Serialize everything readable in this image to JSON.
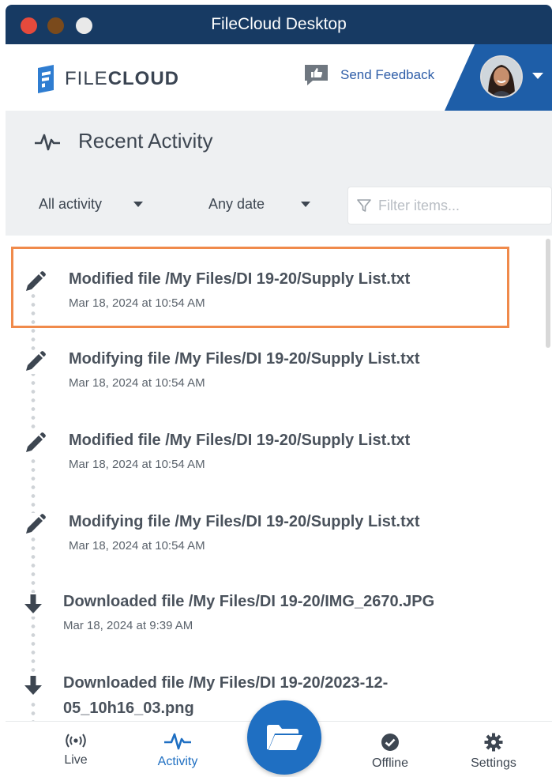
{
  "window": {
    "title": "FileCloud Desktop"
  },
  "header": {
    "logo_text_light": "FILE",
    "logo_text_bold": "CLOUD",
    "feedback_label": "Send Feedback"
  },
  "section": {
    "title": "Recent Activity"
  },
  "filters": {
    "activity_value": "All activity",
    "date_value": "Any date",
    "search_placeholder": "Filter items..."
  },
  "activities": [
    {
      "icon": "pencil-icon",
      "title": "Modified file /My Files/DI 19-20/Supply List.txt",
      "time": "Mar 18, 2024 at 10:54 AM"
    },
    {
      "icon": "pencil-icon",
      "title": "Modifying file /My Files/DI 19-20/Supply List.txt",
      "time": "Mar 18, 2024 at 10:54 AM"
    },
    {
      "icon": "pencil-icon",
      "title": "Modified file /My Files/DI 19-20/Supply List.txt",
      "time": "Mar 18, 2024 at 10:54 AM"
    },
    {
      "icon": "pencil-icon",
      "title": "Modifying file /My Files/DI 19-20/Supply List.txt",
      "time": "Mar 18, 2024 at 10:54 AM"
    },
    {
      "icon": "download-arrow-icon",
      "title": "Downloaded file /My Files/DI 19-20/IMG_2670.JPG",
      "time": "Mar 18, 2024 at 9:39 AM"
    },
    {
      "icon": "download-arrow-icon",
      "title": "Downloaded file /My Files/DI 19-20/2023-12-",
      "title_line2": "05_10h16_03.png"
    }
  ],
  "bottom_nav": {
    "live": "Live",
    "activity": "Activity",
    "offline": "Offline",
    "settings": "Settings"
  },
  "colors": {
    "titlebar": "#173a63",
    "accent": "#1f6fc2",
    "highlight": "#f08a4b"
  }
}
